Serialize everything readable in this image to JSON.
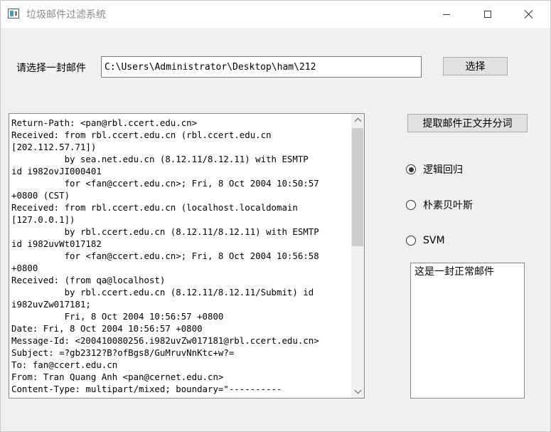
{
  "window": {
    "title": "垃圾邮件过滤系统"
  },
  "file_select": {
    "label": "请选择一封邮件",
    "path_value": "C:\\Users\\Administrator\\Desktop\\ham\\212",
    "select_button": "选择"
  },
  "actions": {
    "extract_button": "提取邮件正文并分词"
  },
  "classifiers": [
    {
      "label": "逻辑回归",
      "checked": true
    },
    {
      "label": "朴素贝叶斯",
      "checked": false
    },
    {
      "label": "SVM",
      "checked": false
    }
  ],
  "mail_content": "Return-Path: <pan@rbl.ccert.edu.cn>\nReceived: from rbl.ccert.edu.cn (rbl.ccert.edu.cn\n[202.112.57.71])\n          by sea.net.edu.cn (8.12.11/8.12.11) with ESMTP\nid i982ovJI000401\n          for <fan@ccert.edu.cn>; Fri, 8 Oct 2004 10:50:57\n+0800 (CST)\nReceived: from rbl.ccert.edu.cn (localhost.localdomain\n[127.0.0.1])\n          by rbl.ccert.edu.cn (8.12.11/8.12.11) with ESMTP\nid i982uvWt017182\n          for <fan@ccert.edu.cn>; Fri, 8 Oct 2004 10:56:58\n+0800\nReceived: (from qa@localhost)\n          by rbl.ccert.edu.cn (8.12.11/8.12.11/Submit) id\ni982uvZw017181;\n          Fri, 8 Oct 2004 10:56:57 +0800\nDate: Fri, 8 Oct 2004 10:56:57 +0800\nMessage-Id: <200410080256.i982uvZw017181@rbl.ccert.edu.cn>\nSubject: =?gb2312?B?ofBgs8/GuMruvNnKtc+w?=\nTo: fan@ccert.edu.cn\nFrom: Tran Quang Anh <pan@cernet.edu.cn>\nContent-Type: multipart/mixed; boundary=\"----------",
  "result": {
    "text": "这是一封正常邮件"
  }
}
